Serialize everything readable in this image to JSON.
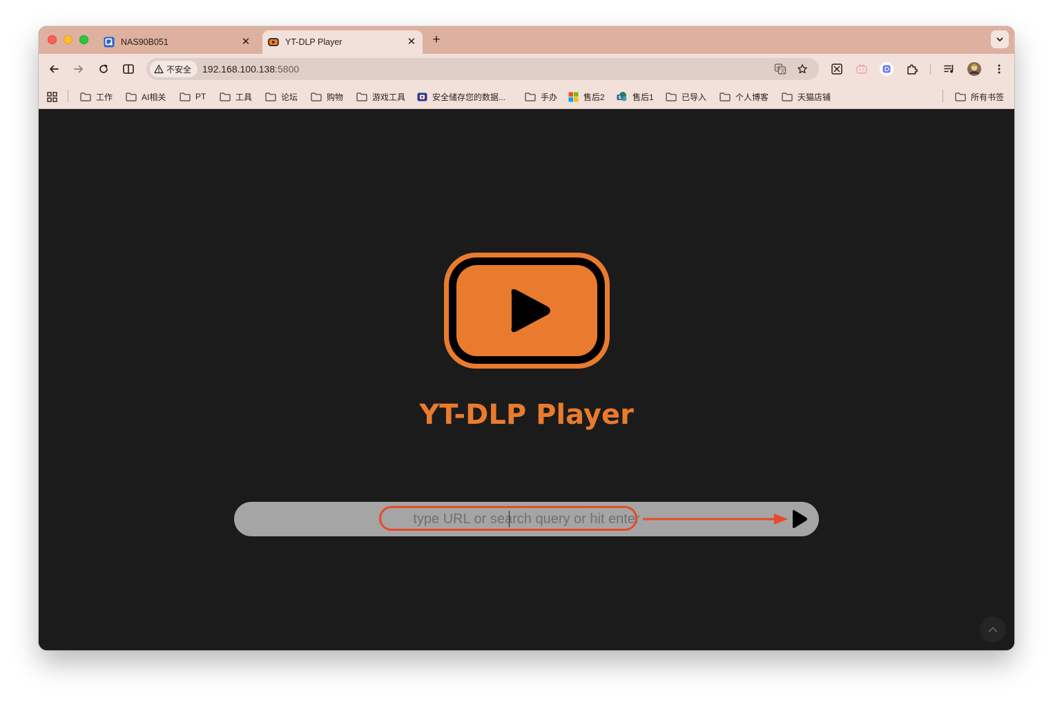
{
  "tabs": [
    {
      "title": "NAS90B051",
      "favicon": "qnap-icon",
      "active": false
    },
    {
      "title": "YT-DLP Player",
      "favicon": "play-logo-icon",
      "active": true
    }
  ],
  "toolbar": {
    "security_label": "不安全",
    "url_host": "192.168.100.138",
    "url_port": ":5800"
  },
  "bookmarks": [
    {
      "label": "工作",
      "icon": "folder-icon"
    },
    {
      "label": "AI相关",
      "icon": "folder-icon"
    },
    {
      "label": "PT",
      "icon": "folder-icon"
    },
    {
      "label": "工具",
      "icon": "folder-icon"
    },
    {
      "label": "论坛",
      "icon": "folder-icon"
    },
    {
      "label": "购物",
      "icon": "folder-icon"
    },
    {
      "label": "游戏工具",
      "icon": "folder-icon"
    },
    {
      "label": "安全储存您的数据...",
      "icon": "site-icon"
    },
    {
      "label": "手办",
      "icon": "folder-icon"
    },
    {
      "label": "售后2",
      "icon": "microsoft-icon"
    },
    {
      "label": "售后1",
      "icon": "sharepoint-icon"
    },
    {
      "label": "已导入",
      "icon": "folder-icon"
    },
    {
      "label": "个人博客",
      "icon": "folder-icon"
    },
    {
      "label": "天猫店铺",
      "icon": "folder-icon"
    }
  ],
  "all_bookmarks_label": "所有书签",
  "app": {
    "title": "YT-DLP Player",
    "search_placeholder": "type URL or search query or hit enter",
    "accent_color": "#e97b2e"
  }
}
